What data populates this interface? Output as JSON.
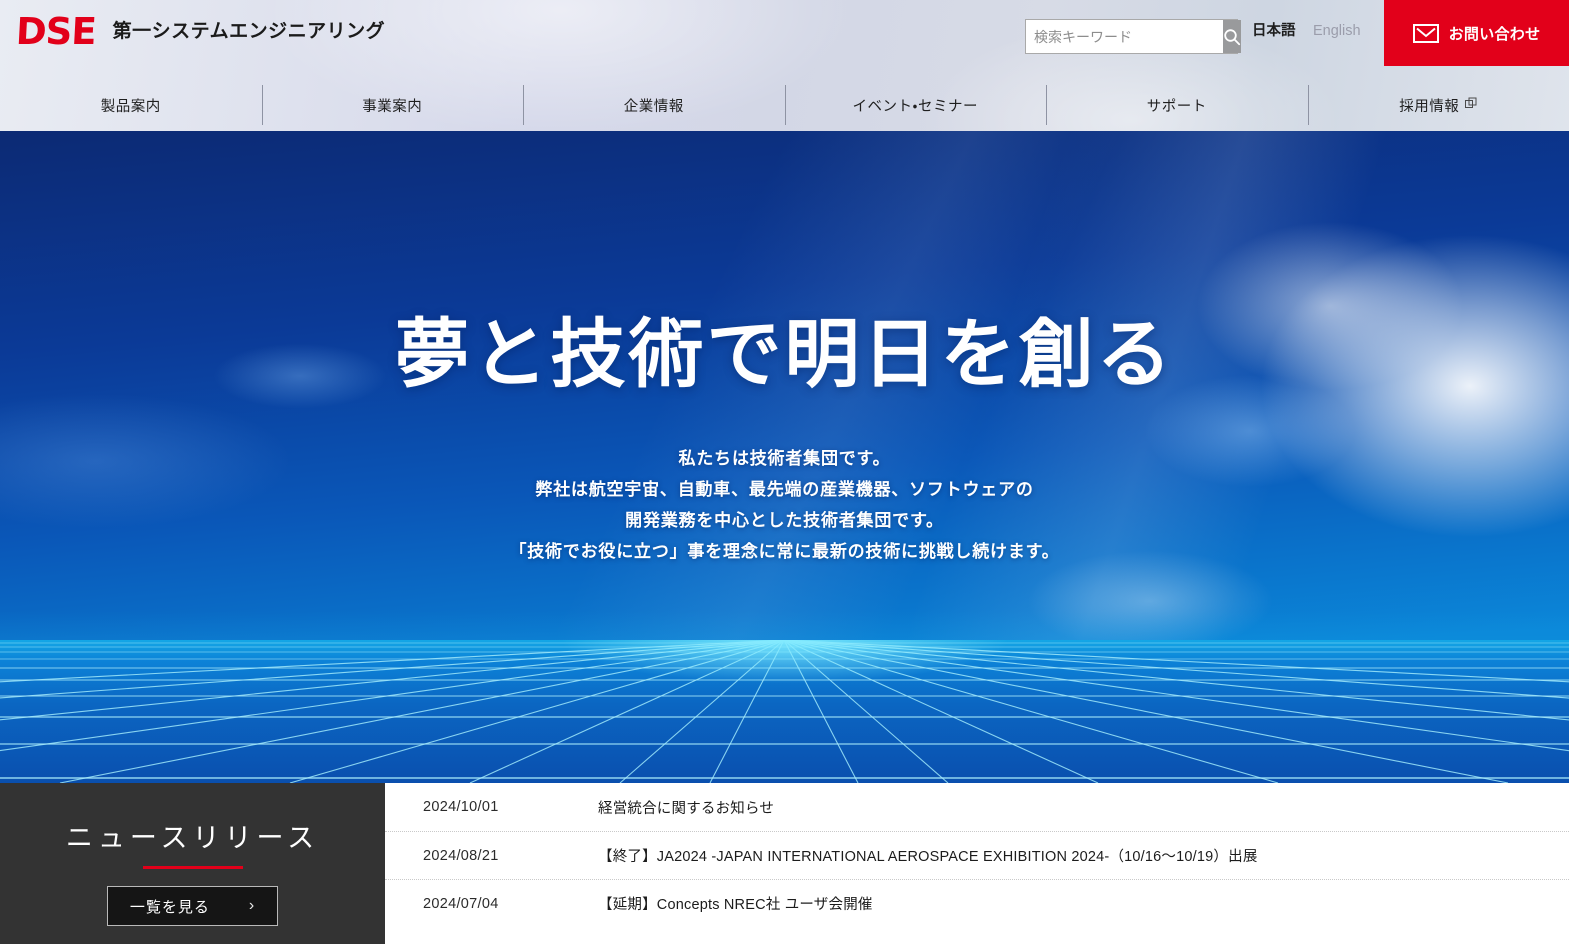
{
  "header": {
    "logo_mark": "DSE",
    "logo_name": "第一システムエンジニアリング",
    "search": {
      "placeholder": "検索キーワード",
      "value": "",
      "button_icon": "search-icon"
    },
    "languages": [
      {
        "label": "日本語",
        "active": true
      },
      {
        "label": "English",
        "active": false
      }
    ],
    "contact": {
      "label": "お問い合わせ",
      "icon": "envelope-icon",
      "color": "#e2001a"
    }
  },
  "nav": {
    "items": [
      {
        "label": "製品案内",
        "external": false
      },
      {
        "label": "事業案内",
        "external": false
      },
      {
        "label": "企業情報",
        "external": false
      },
      {
        "label": "イベント・セミナー",
        "external": false
      },
      {
        "label": "サポート",
        "external": false
      },
      {
        "label": "採用情報",
        "external": true
      }
    ]
  },
  "hero": {
    "title": "夢と技術で明日を創る",
    "lines": [
      "私たちは技術者集団です。",
      "弊社は航空宇宙、自動車、最先端の産業機器、ソフトウェアの",
      "開発業務を中心とした技術者集団です。",
      "「技術でお役に立つ」事を理念に常に最新の技術に挑戦し続けます。"
    ]
  },
  "news": {
    "heading": "ニュースリリース",
    "more_label": "一覧を見る",
    "more_chevron": "›",
    "accent_color": "#e2001a",
    "panel_color": "#333333",
    "items": [
      {
        "date": "2024/10/01",
        "title": "経営統合に関するお知らせ"
      },
      {
        "date": "2024/08/21",
        "title": "【終了】JA2024 -JAPAN INTERNATIONAL AEROSPACE EXHIBITION 2024-（10/16〜10/19）出展"
      },
      {
        "date": "2024/07/04",
        "title": "【延期】Concepts NREC社 ユーザ会開催"
      }
    ]
  }
}
